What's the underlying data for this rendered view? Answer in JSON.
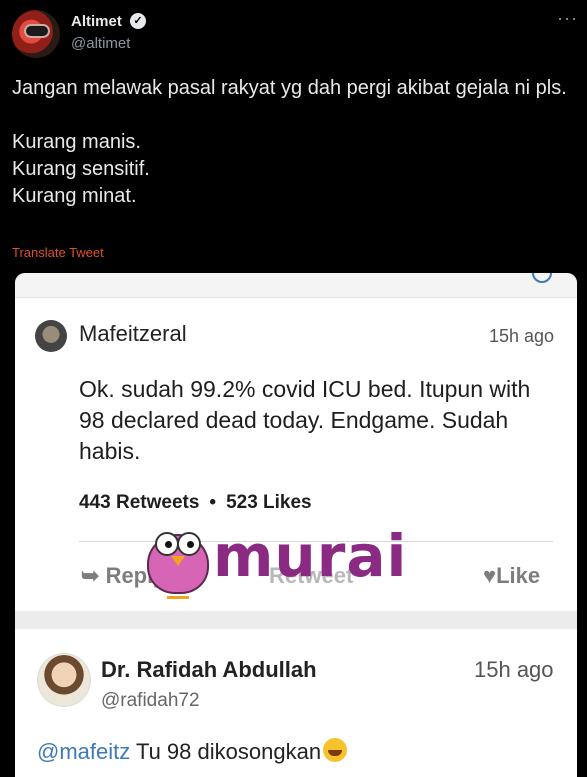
{
  "tweet": {
    "display_name": "Altimet",
    "handle": "@altimet",
    "text": "Jangan melawak pasal rakyat yg dah pergi akibat gejala ni pls.\n\nKurang manis.\nKurang sensitif.\nKurang minat.",
    "translate_label": "Translate Tweet"
  },
  "embedded": {
    "main_post": {
      "author": "Mafeitzeral",
      "time": "15h ago",
      "text": "Ok. sudah 99.2% covid ICU bed. Itupun with 98 declared dead today. Endgame. Sudah habis.",
      "retweets": "443 Retweets",
      "likes": "523 Likes",
      "actions": {
        "reply": "Reply",
        "retweet": "Retweet",
        "like": "Like"
      }
    },
    "reply_post": {
      "author": "Dr. Rafidah Abdullah",
      "handle": "@rafidah72",
      "time": "15h ago",
      "mention": "@mafeitz",
      "text": " Tu 98 dikosongkan"
    },
    "watermark": "murai"
  },
  "colors": {
    "background": "#000000",
    "translate": "#e0512a",
    "watermark": "#8b2a82"
  }
}
